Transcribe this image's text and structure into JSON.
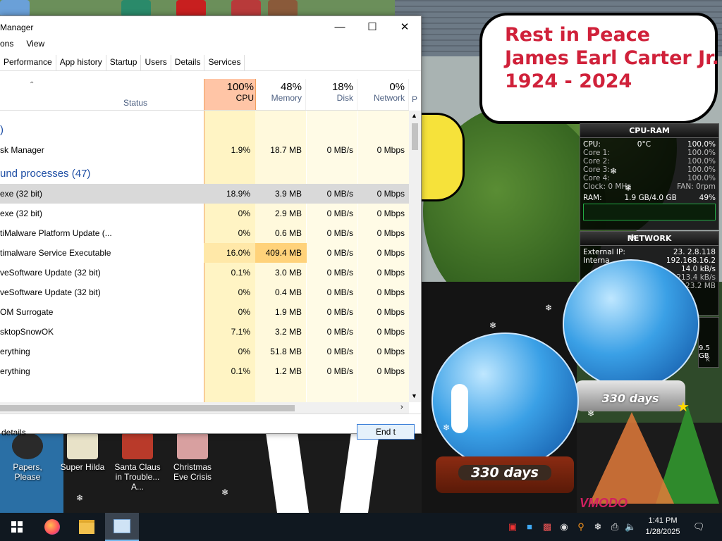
{
  "window": {
    "title": "Manager",
    "menu": [
      "ons",
      "View"
    ],
    "tabs": [
      "Performance",
      "App history",
      "Startup",
      "Users",
      "Details",
      "Services"
    ],
    "columns": {
      "status": "Status",
      "cpu": {
        "pct": "100%",
        "name": "CPU"
      },
      "memory": {
        "pct": "48%",
        "name": "Memory"
      },
      "disk": {
        "pct": "18%",
        "name": "Disk"
      },
      "network": {
        "pct": "0%",
        "name": "Network"
      },
      "extra": "P"
    },
    "rows": [
      {
        "type": "group",
        "name": ")"
      },
      {
        "type": "proc",
        "name": "sk Manager",
        "cpu": "1.9%",
        "mem": "18.7 MB",
        "disk": "0 MB/s",
        "net": "0 Mbps"
      },
      {
        "type": "group",
        "name": "und processes (47)"
      },
      {
        "type": "proc",
        "name": "exe (32 bit)",
        "cpu": "18.9%",
        "mem": "3.9 MB",
        "disk": "0 MB/s",
        "net": "0 Mbps",
        "selected": true
      },
      {
        "type": "proc",
        "name": "exe (32 bit)",
        "cpu": "0%",
        "mem": "2.9 MB",
        "disk": "0 MB/s",
        "net": "0 Mbps"
      },
      {
        "type": "proc",
        "name": "tiMalware Platform Update (...",
        "cpu": "0%",
        "mem": "0.6 MB",
        "disk": "0 MB/s",
        "net": "0 Mbps"
      },
      {
        "type": "proc",
        "name": "timalware Service Executable",
        "cpu": "16.0%",
        "mem": "409.4 MB",
        "disk": "0 MB/s",
        "net": "0 Mbps",
        "highmem": true
      },
      {
        "type": "proc",
        "name": "veSoftware Update (32 bit)",
        "cpu": "0.1%",
        "mem": "3.0 MB",
        "disk": "0 MB/s",
        "net": "0 Mbps"
      },
      {
        "type": "proc",
        "name": "veSoftware Update (32 bit)",
        "cpu": "0%",
        "mem": "0.4 MB",
        "disk": "0 MB/s",
        "net": "0 Mbps"
      },
      {
        "type": "proc",
        "name": "OM Surrogate",
        "cpu": "0%",
        "mem": "1.9 MB",
        "disk": "0 MB/s",
        "net": "0 Mbps"
      },
      {
        "type": "proc",
        "name": "sktopSnowOK",
        "cpu": "7.1%",
        "mem": "3.2 MB",
        "disk": "0 MB/s",
        "net": "0 Mbps"
      },
      {
        "type": "proc",
        "name": "erything",
        "cpu": "0%",
        "mem": "51.8 MB",
        "disk": "0 MB/s",
        "net": "0 Mbps"
      },
      {
        "type": "proc",
        "name": "erything",
        "cpu": "0.1%",
        "mem": "1.2 MB",
        "disk": "0 MB/s",
        "net": "0 Mbps"
      }
    ],
    "footer": {
      "details": "details",
      "end_button": "End t"
    }
  },
  "speech_bubble": [
    "Rest in Peace",
    "James Earl Carter Jr.",
    "1924 - 2024"
  ],
  "cpu_gadget": {
    "title": "CPU-RAM",
    "cpu_label": "CPU:",
    "cpu_temp": "0°C",
    "cpu_value": "100.0%",
    "cores": [
      {
        "label": "Core 1:",
        "value": "100.0%"
      },
      {
        "label": "Core 2:",
        "value": "100.0%"
      },
      {
        "label": "Core 3:",
        "value": "100.0%"
      },
      {
        "label": "Core 4:",
        "value": "100.0%"
      }
    ],
    "clock": "Clock: 0 MHz",
    "fan": "FAN: 0rpm",
    "ram_label": "RAM:",
    "ram_value": "1.9 GB/4.0 GB",
    "ram_pct": "49%"
  },
  "net_gadget": {
    "title": "NETWORK",
    "ext_label": "External IP:",
    "ext_value": "23.  2.8.118",
    "int_label": "Interna",
    "int_value": "192.168.16.2",
    "up": "14.0 kB/s",
    "up2": "213.4 kB/s",
    "total": "23.2 MB",
    "disk_value": "9.5 GB",
    "disk_k": "k"
  },
  "globes": {
    "left_days": "330 days",
    "right_days": "330 days"
  },
  "desktop_icons": [
    "Papers, Please",
    "Super Hilda",
    "Santa Claus in Trouble... A...",
    "Christmas Eve Crisis"
  ],
  "taskbar": {
    "time": "1:41 PM",
    "date": "1/28/2025"
  },
  "watermark": "VMODO"
}
